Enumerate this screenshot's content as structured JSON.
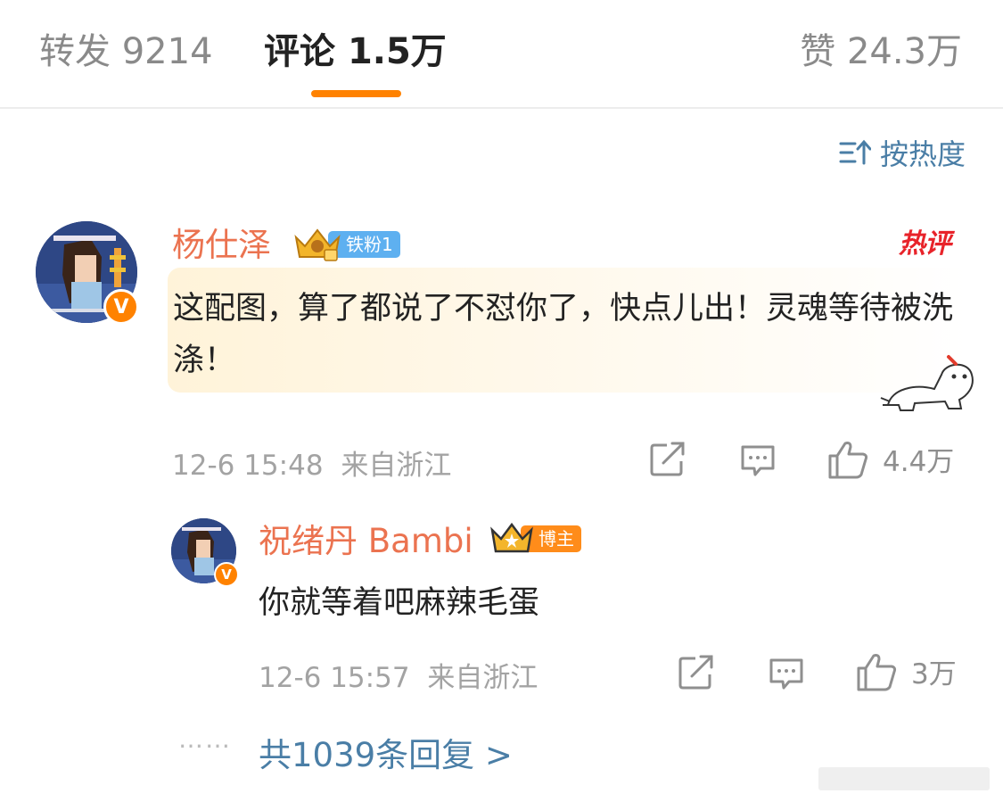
{
  "tabs": {
    "repost_label": "转发",
    "repost_count": "9214",
    "comment_label": "评论",
    "comment_count": "1.5万",
    "like_label": "赞",
    "like_count": "24.3万"
  },
  "sort": {
    "label": "按热度"
  },
  "comment": {
    "username": "杨仕泽",
    "fan_badge": "铁粉1",
    "hot_tag": "热评",
    "text": "这配图，算了都说了不怼你了，快点儿出！灵魂等待被洗涤！",
    "timestamp": "12-6 15:48",
    "location": "来自浙江",
    "like_count": "4.4万"
  },
  "reply": {
    "username": "祝绪丹 Bambi",
    "badge": "博主",
    "text": "你就等着吧麻辣毛蛋",
    "timestamp": "12-6 15:57",
    "location": "来自浙江",
    "like_count": "3万"
  },
  "more_replies": {
    "dots": "……",
    "label": "共1039条回复 >"
  },
  "colors": {
    "accent": "#ff8200",
    "username": "#eb7350",
    "link": "#4a7ea6",
    "hot": "#e8232a",
    "fan_badge": "#5eb0f0",
    "blogger_badge": "#ff8c1a"
  },
  "icons": [
    "sort-icon",
    "verified-icon",
    "crown-icon",
    "share-icon",
    "comment-icon",
    "like-icon"
  ]
}
